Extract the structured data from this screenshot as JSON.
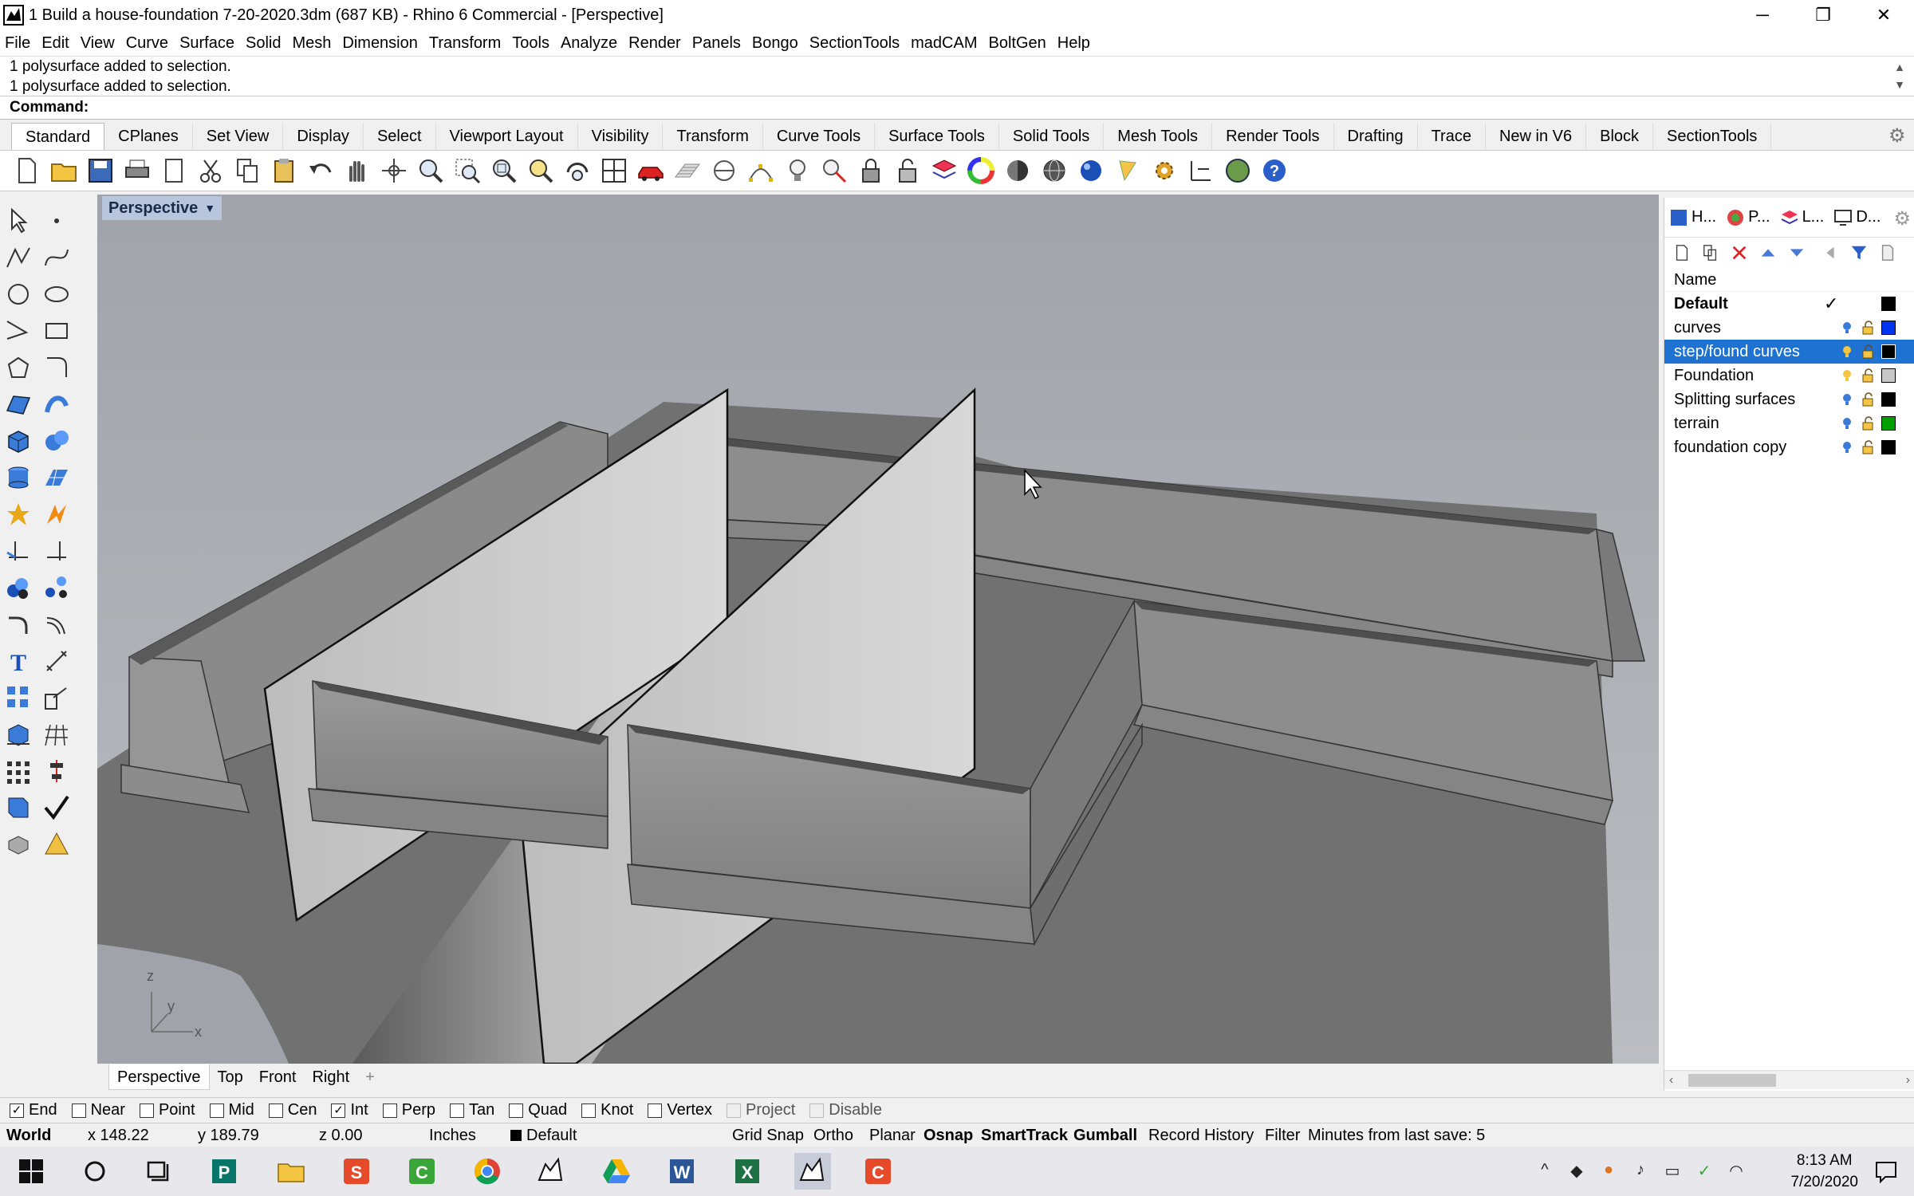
{
  "titlebar": {
    "title": "1 Build a house-foundation 7-20-2020.3dm (687 KB) - Rhino 6 Commercial - [Perspective]",
    "minimize": "─",
    "restore": "❐",
    "close": "✕"
  },
  "menu": [
    "File",
    "Edit",
    "View",
    "Curve",
    "Surface",
    "Solid",
    "Mesh",
    "Dimension",
    "Transform",
    "Tools",
    "Analyze",
    "Render",
    "Panels",
    "Bongo",
    "SectionTools",
    "madCAM",
    "BoltGen",
    "Help"
  ],
  "command_history": [
    "1 polysurface added to selection.",
    "1 polysurface added to selection."
  ],
  "command_prompt": "Command:",
  "toolbar_tabs": [
    "Standard",
    "CPlanes",
    "Set View",
    "Display",
    "Select",
    "Viewport Layout",
    "Visibility",
    "Transform",
    "Curve Tools",
    "Surface Tools",
    "Solid Tools",
    "Mesh Tools",
    "Render Tools",
    "Drafting",
    "Trace",
    "New in V6",
    "Block",
    "SectionTools"
  ],
  "active_toolbar_tab": "Standard",
  "viewport": {
    "title": "Perspective",
    "axes": {
      "z": "z",
      "y": "y",
      "x": "x"
    }
  },
  "view_tabs": [
    "Perspective",
    "Top",
    "Front",
    "Right"
  ],
  "view_tab_add": "+",
  "panel": {
    "tabs": [
      "H...",
      "P...",
      "L...",
      "D..."
    ],
    "layer_column": "Name",
    "layers": [
      {
        "name": "Default",
        "current": true,
        "color": "#000000"
      },
      {
        "name": "curves",
        "color": "#0033ee"
      },
      {
        "name": "step/found curves",
        "selected": true,
        "color": "#000000"
      },
      {
        "name": "Foundation",
        "color": "#c8c8c8"
      },
      {
        "name": "Splitting surfaces",
        "color": "#000000"
      },
      {
        "name": "terrain",
        "color": "#00a000"
      },
      {
        "name": "foundation copy",
        "color": "#000000"
      }
    ],
    "current_mark": "✓"
  },
  "osnaps": [
    {
      "label": "End",
      "checked": true
    },
    {
      "label": "Near",
      "checked": false
    },
    {
      "label": "Point",
      "checked": false
    },
    {
      "label": "Mid",
      "checked": false
    },
    {
      "label": "Cen",
      "checked": false
    },
    {
      "label": "Int",
      "checked": true
    },
    {
      "label": "Perp",
      "checked": false
    },
    {
      "label": "Tan",
      "checked": false
    },
    {
      "label": "Quad",
      "checked": false
    },
    {
      "label": "Knot",
      "checked": false
    },
    {
      "label": "Vertex",
      "checked": false
    },
    {
      "label": "Project",
      "checked": false,
      "disabled": true
    },
    {
      "label": "Disable",
      "checked": false,
      "disabled": true
    }
  ],
  "status": {
    "cplane": "World",
    "x": "x 148.22",
    "y": "y 189.79",
    "z": "z 0.00",
    "units": "Inches",
    "layer": "Default",
    "grid_snap": "Grid Snap",
    "ortho": "Ortho",
    "planar": "Planar",
    "osnap": "Osnap",
    "smarttrack": "SmartTrack",
    "gumball": "Gumball",
    "record_history": "Record History",
    "filter": "Filter",
    "save_info": "Minutes from last save: 5"
  },
  "taskbar": {
    "time": "8:13 AM",
    "date": "7/20/2020"
  }
}
